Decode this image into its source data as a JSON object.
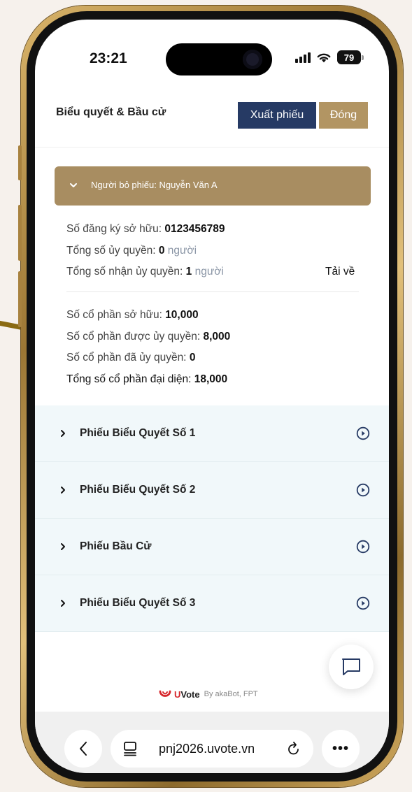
{
  "status_bar": {
    "time": "23:21",
    "battery": "79"
  },
  "header": {
    "title": "Biểu quyết & Bầu cử",
    "export_label": "Xuất phiếu",
    "close_label": "Đóng"
  },
  "voter": {
    "panel_label": "Người bỏ phiếu: Nguyễn Văn A",
    "ownership_reg_label": "Số đăng ký sở hữu:",
    "ownership_reg_value": "0123456789",
    "proxies_given_label": "Tổng số ủy quyền:",
    "proxies_given_value": "0",
    "proxies_given_unit": "người",
    "proxies_received_label": "Tổng số nhận ủy quyền:",
    "proxies_received_value": "1",
    "proxies_received_unit": "người",
    "download_label": "Tải về",
    "shares_owned_label": "Số cổ phần sở hữu:",
    "shares_owned_value": "10,000",
    "shares_received_label": "Số cổ phần được ủy quyền:",
    "shares_received_value": "8,000",
    "shares_given_label": "Số cổ phần đã ủy quyền:",
    "shares_given_value": "0",
    "shares_total_label": "Tổng số cổ phần đại diện:",
    "shares_total_value": "18,000"
  },
  "ballots": [
    {
      "title": "Phiếu Biểu Quyết Số 1"
    },
    {
      "title": "Phiếu Biểu Quyết Số 2"
    },
    {
      "title": "Phiếu Bầu Cử"
    },
    {
      "title": "Phiếu Biểu Quyết Số 3"
    }
  ],
  "footer": {
    "brand_u": "U",
    "brand_rest": "Vote",
    "by": "By akaBot, FPT"
  },
  "browser": {
    "url": "pnj2026.uvote.vn"
  },
  "colors": {
    "navy": "#263a64",
    "gold": "#b29563",
    "panel": "#a88d61",
    "ballot_bg": "#f1f8fa",
    "brand_red": "#d6262b"
  },
  "icons": [
    "chevron-down-icon",
    "chevron-right-icon",
    "play-circle-icon",
    "chat-icon",
    "back-icon",
    "tabs-icon",
    "reload-icon",
    "more-icon",
    "wifi-icon",
    "signal-icon",
    "battery-icon",
    "uvote-logo-icon"
  ]
}
